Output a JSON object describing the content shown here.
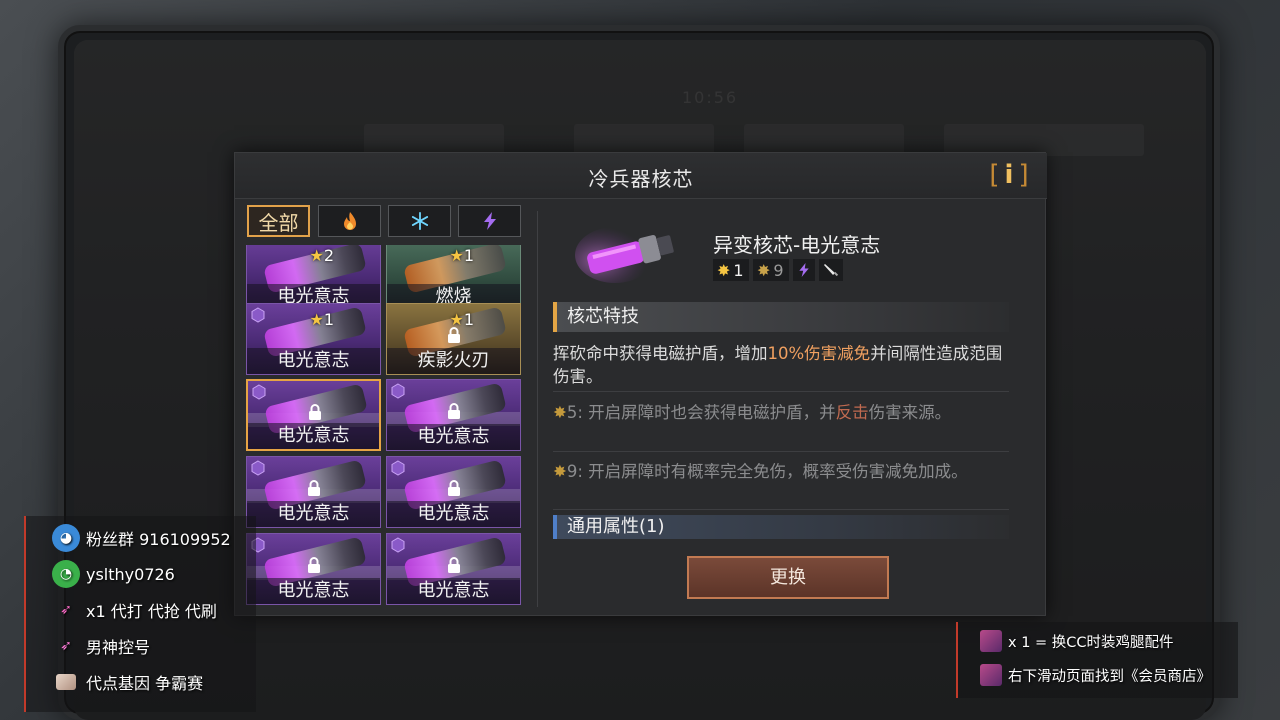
{
  "background": {
    "time": "10:56"
  },
  "dialog": {
    "title": "冷兵器核芯",
    "info_icon": "i",
    "tabs": [
      {
        "label": "全部",
        "active": true
      },
      {
        "icon": "fire-icon"
      },
      {
        "icon": "snowflake-icon"
      },
      {
        "icon": "lightning-icon"
      }
    ],
    "cores": [
      {
        "name": "电光意志",
        "stars": "2",
        "style": "purple",
        "locked": false
      },
      {
        "name": "燃烧",
        "stars": "1",
        "style": "green",
        "locked": false
      },
      {
        "name": "电光意志",
        "stars": "1",
        "style": "purple",
        "locked": false
      },
      {
        "name": "疾影火刃",
        "stars": "1",
        "style": "gold",
        "locked": true
      },
      {
        "name": "电光意志",
        "stars": "",
        "style": "purple",
        "locked": true,
        "selected": true
      },
      {
        "name": "电光意志",
        "stars": "",
        "style": "purple",
        "locked": true
      },
      {
        "name": "电光意志",
        "stars": "",
        "style": "purple",
        "locked": true
      },
      {
        "name": "电光意志",
        "stars": "",
        "style": "purple",
        "locked": true
      },
      {
        "name": "电光意志",
        "stars": "",
        "style": "purple",
        "locked": true
      },
      {
        "name": "电光意志",
        "stars": "",
        "style": "purple",
        "locked": true
      }
    ],
    "detail": {
      "name": "异变核芯-电光意志",
      "star_level": "1",
      "max_star": "9",
      "skill_title": "核芯特技",
      "skill_desc_pre": "挥砍命中获得电磁护盾，增加",
      "skill_desc_hl": "10%伤害减免",
      "skill_desc_post": "并间隔性造成范围伤害。",
      "star5_tag": "5",
      "star5_pre": ": 开启屏障时也会获得电磁护盾，并",
      "star5_hl": "反击",
      "star5_post": "伤害来源。",
      "star9_tag": "9",
      "star9_text": ": 开启屏障时有概率完全免伤，概率受伤害减免加成。",
      "general_title": "通用属性(1)",
      "replace_label": "更换"
    }
  },
  "stream": {
    "left": [
      {
        "icon": "qq-icon",
        "text": "粉丝群 916109952"
      },
      {
        "icon": "wechat-icon",
        "text": "yslthy0726"
      },
      {
        "icon": "rocket-icon",
        "text": "x1 代打 代抢 代刷"
      },
      {
        "icon": "rocket-icon",
        "text": "男神控号"
      },
      {
        "icon": "ticket-icon",
        "text": "代点基因 争霸赛"
      }
    ],
    "right": [
      {
        "icon": "ticket-icon",
        "text": "x 1 = 换CC时装鸡腿配件"
      },
      {
        "icon": "ticket-icon",
        "text": "右下滑动页面找到《会员商店》"
      }
    ]
  }
}
